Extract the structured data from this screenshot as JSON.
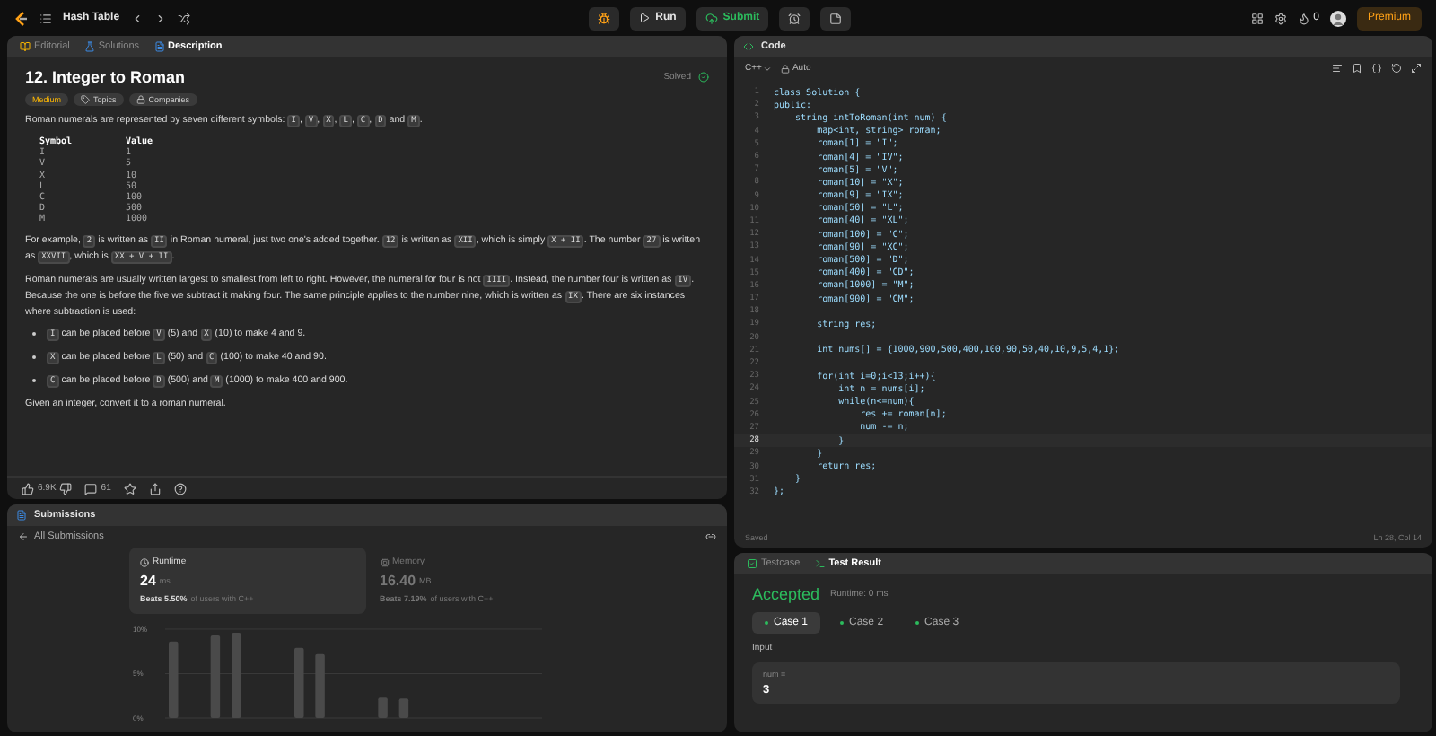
{
  "topbar": {
    "problem_list": "Hash Table",
    "run": "Run",
    "submit": "Submit",
    "streak": "0",
    "premium": "Premium"
  },
  "problem": {
    "tabs": [
      {
        "label": "Editorial",
        "kind": "editorial",
        "selected": false
      },
      {
        "label": "Solutions",
        "kind": "solutions",
        "selected": false
      },
      {
        "label": "Description",
        "kind": "description",
        "selected": true
      }
    ],
    "title": "12. Integer to Roman",
    "status": "Solved",
    "difficulty": "Medium",
    "tags": [
      "Topics",
      "Companies"
    ],
    "intro": [
      {
        "text": "Roman numerals are represented by seven different symbols: ",
        "code": false
      },
      {
        "text": "I",
        "code": true
      },
      {
        "text": ", ",
        "code": false
      },
      {
        "text": "V",
        "code": true
      },
      {
        "text": ", ",
        "code": false
      },
      {
        "text": "X",
        "code": true
      },
      {
        "text": ", ",
        "code": false
      },
      {
        "text": "L",
        "code": true
      },
      {
        "text": ", ",
        "code": false
      },
      {
        "text": "C",
        "code": true
      },
      {
        "text": ", ",
        "code": false
      },
      {
        "text": "D",
        "code": true
      },
      {
        "text": " and ",
        "code": false
      },
      {
        "text": "M",
        "code": true
      },
      {
        "text": ".",
        "code": false
      }
    ],
    "symbol_table": {
      "columns": [
        "Symbol",
        "Value"
      ],
      "rows": [
        [
          "I",
          "1"
        ],
        [
          "V",
          "5"
        ],
        [
          "X",
          "10"
        ],
        [
          "L",
          "50"
        ],
        [
          "C",
          "100"
        ],
        [
          "D",
          "500"
        ],
        [
          "M",
          "1000"
        ]
      ]
    },
    "paragraphs": [
      [
        {
          "text": "For example, ",
          "code": false
        },
        {
          "text": "2",
          "code": true
        },
        {
          "text": " is written as ",
          "code": false
        },
        {
          "text": "II",
          "code": true
        },
        {
          "text": " in Roman numeral, just two one's added together. ",
          "code": false
        },
        {
          "text": "12",
          "code": true
        },
        {
          "text": " is written as ",
          "code": false
        },
        {
          "text": "XII",
          "code": true
        },
        {
          "text": ", which is simply ",
          "code": false
        },
        {
          "text": "X + II",
          "code": true
        },
        {
          "text": ". The number ",
          "code": false
        },
        {
          "text": "27",
          "code": true
        },
        {
          "text": " is written as ",
          "code": false
        },
        {
          "text": "XXVII",
          "code": true
        },
        {
          "text": ", which is ",
          "code": false
        },
        {
          "text": "XX + V + II",
          "code": true
        },
        {
          "text": ".",
          "code": false
        }
      ],
      [
        {
          "text": "Roman numerals are usually written largest to smallest from left to right. However, the numeral for four is not ",
          "code": false
        },
        {
          "text": "IIII",
          "code": true
        },
        {
          "text": ". Instead, the number four is written as ",
          "code": false
        },
        {
          "text": "IV",
          "code": true
        },
        {
          "text": ". Because the one is before the five we subtract it making four. The same principle applies to the number nine, which is written as ",
          "code": false
        },
        {
          "text": "IX",
          "code": true
        },
        {
          "text": ". There are six instances where subtraction is used:",
          "code": false
        }
      ]
    ],
    "bullets": [
      [
        {
          "text": "I",
          "code": true
        },
        {
          "text": " can be placed before ",
          "code": false
        },
        {
          "text": "V",
          "code": true
        },
        {
          "text": " (5) and ",
          "code": false
        },
        {
          "text": "X",
          "code": true
        },
        {
          "text": " (10) to make 4 and 9.",
          "code": false
        }
      ],
      [
        {
          "text": "X",
          "code": true
        },
        {
          "text": " can be placed before ",
          "code": false
        },
        {
          "text": "L",
          "code": true
        },
        {
          "text": " (50) and ",
          "code": false
        },
        {
          "text": "C",
          "code": true
        },
        {
          "text": " (100) to make 40 and 90.",
          "code": false
        }
      ],
      [
        {
          "text": "C",
          "code": true
        },
        {
          "text": " can be placed before ",
          "code": false
        },
        {
          "text": "D",
          "code": true
        },
        {
          "text": " (500) and ",
          "code": false
        },
        {
          "text": "M",
          "code": true
        },
        {
          "text": " (1000) to make 400 and 900.",
          "code": false
        }
      ]
    ],
    "closing": [
      {
        "text": "Given an integer, convert it to a roman numeral.",
        "code": false
      }
    ],
    "likes": "6.9K",
    "comments": "61"
  },
  "submissions": {
    "title": "Submissions",
    "back": "All Submissions",
    "cards": [
      {
        "kind": "runtime",
        "label": "Runtime",
        "value": "24",
        "unit": "ms",
        "beats": "Beats 5.50%",
        "rest": "of users with C++",
        "selected": true
      },
      {
        "kind": "memory",
        "label": "Memory",
        "value": "16.40",
        "unit": "MB",
        "beats": "Beats 7.19%",
        "rest": "of users with C++",
        "selected": false
      }
    ],
    "chart_data": {
      "type": "bar",
      "ylim": [
        0,
        10.5
      ],
      "yticks": [
        {
          "value": 10,
          "label": "10%"
        },
        {
          "value": 5,
          "label": "5%"
        },
        {
          "value": 0,
          "label": "0%"
        }
      ],
      "values": [
        8.6,
        null,
        9.3,
        9.6,
        null,
        null,
        7.9,
        7.2,
        null,
        null,
        2.3,
        2.2,
        null,
        null,
        null,
        null,
        null,
        null
      ]
    }
  },
  "code": {
    "title": "Code",
    "language": "C++",
    "mode": "Auto",
    "lines": [
      {
        "number": "1",
        "text": "class Solution {",
        "active": false
      },
      {
        "number": "2",
        "text": "public:",
        "active": false
      },
      {
        "number": "3",
        "text": "    string intToRoman(int num) {",
        "active": false
      },
      {
        "number": "4",
        "text": "        map<int, string> roman;",
        "active": false
      },
      {
        "number": "5",
        "text": "        roman[1] = \"I\";",
        "active": false
      },
      {
        "number": "6",
        "text": "        roman[4] = \"IV\";",
        "active": false
      },
      {
        "number": "7",
        "text": "        roman[5] = \"V\";",
        "active": false
      },
      {
        "number": "8",
        "text": "        roman[10] = \"X\";",
        "active": false
      },
      {
        "number": "9",
        "text": "        roman[9] = \"IX\";",
        "active": false
      },
      {
        "number": "10",
        "text": "        roman[50] = \"L\";",
        "active": false
      },
      {
        "number": "11",
        "text": "        roman[40] = \"XL\";",
        "active": false
      },
      {
        "number": "12",
        "text": "        roman[100] = \"C\";",
        "active": false
      },
      {
        "number": "13",
        "text": "        roman[90] = \"XC\";",
        "active": false
      },
      {
        "number": "14",
        "text": "        roman[500] = \"D\";",
        "active": false
      },
      {
        "number": "15",
        "text": "        roman[400] = \"CD\";",
        "active": false
      },
      {
        "number": "16",
        "text": "        roman[1000] = \"M\";",
        "active": false
      },
      {
        "number": "17",
        "text": "        roman[900] = \"CM\";",
        "active": false
      },
      {
        "number": "18",
        "active": false
      },
      {
        "number": "19",
        "text": "        string res;",
        "active": false
      },
      {
        "number": "20",
        "active": false
      },
      {
        "number": "21",
        "text": "        int nums[] = {1000,900,500,400,100,90,50,40,10,9,5,4,1};",
        "active": false
      },
      {
        "number": "22",
        "active": false
      },
      {
        "number": "23",
        "text": "        for(int i=0;i<13;i++){",
        "active": false
      },
      {
        "number": "24",
        "text": "            int n = nums[i];",
        "active": false
      },
      {
        "number": "25",
        "text": "            while(n<=num){",
        "active": false
      },
      {
        "number": "26",
        "text": "                res += roman[n];",
        "active": false
      },
      {
        "number": "27",
        "text": "                num -= n;",
        "active": false
      },
      {
        "number": "28",
        "text": "            }",
        "active": true
      },
      {
        "number": "29",
        "text": "        }",
        "active": false
      },
      {
        "number": "30",
        "text": "        return res;",
        "active": false
      },
      {
        "number": "31",
        "text": "    }",
        "active": false
      },
      {
        "number": "32",
        "text": "};",
        "active": false
      }
    ],
    "saved": "Saved",
    "cursor": "Ln 28, Col 14"
  },
  "test": {
    "tabs": [
      {
        "label": "Testcase",
        "kind": "testcase",
        "selected": false
      },
      {
        "label": "Test Result",
        "kind": "result",
        "selected": true
      }
    ],
    "verdict": "Accepted",
    "runtime": "Runtime: 0 ms",
    "cases": [
      {
        "label": "Case 1",
        "selected": true
      },
      {
        "label": "Case 2",
        "selected": false
      },
      {
        "label": "Case 3",
        "selected": false
      }
    ],
    "input_label": "Input",
    "var": "num =",
    "value": "3"
  }
}
